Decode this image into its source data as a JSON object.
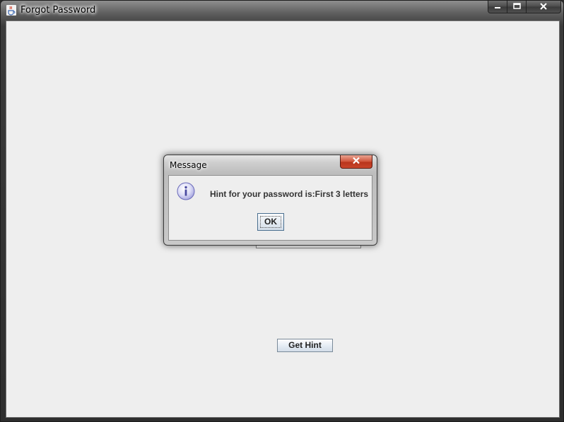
{
  "window": {
    "title": "Forgot Password",
    "icon": "java-cup-icon"
  },
  "caption_buttons": {
    "minimize": "minimize-icon",
    "maximize": "maximize-icon",
    "close": "close-icon"
  },
  "main": {
    "get_hint_label": "Get Hint"
  },
  "dialog": {
    "title": "Message",
    "icon": "info-icon",
    "message": "Hint for your password is:First 3 letters",
    "ok_label": "OK"
  }
}
